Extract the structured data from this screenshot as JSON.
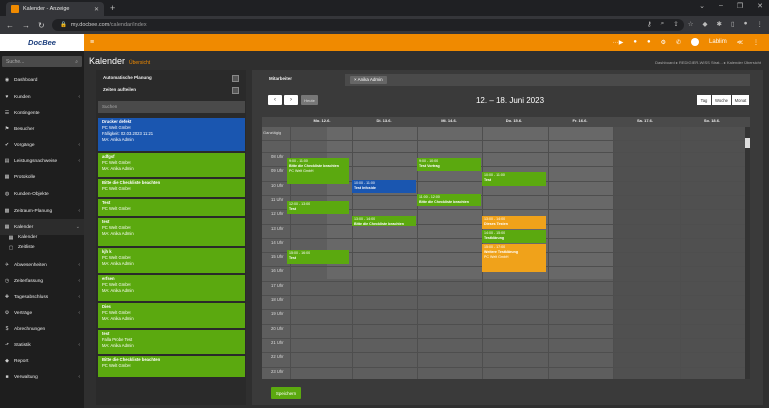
{
  "browser": {
    "tab_title": "Kalender - Anzeige",
    "url_host": "my.docbee.com",
    "url_path": "/calendar/index"
  },
  "app": {
    "logo": "DocBee",
    "page_title": "Kalender",
    "page_subtitle": "Übersicht",
    "breadcrumb": "Dashboard  ▸  REDIGIER-WISS Strat...  ▸  Kalender Übersicht",
    "user": "Lablim"
  },
  "sidebar": {
    "search_placeholder": "Suche...",
    "items": [
      {
        "icon": "◉",
        "label": "Dashboard",
        "chevron": ""
      },
      {
        "icon": "♥",
        "label": "Kunden",
        "chevron": "‹"
      },
      {
        "icon": "☰",
        "label": "Kontingente",
        "chevron": ""
      },
      {
        "icon": "⚑",
        "label": "Besucher",
        "chevron": ""
      },
      {
        "icon": "✔",
        "label": "Vorgänge",
        "chevron": "‹"
      },
      {
        "icon": "▤",
        "label": "Leistungsnachweise",
        "chevron": "‹"
      },
      {
        "icon": "▦",
        "label": "Protokolle",
        "chevron": ""
      },
      {
        "icon": "◍",
        "label": "Kunden-Objekte",
        "chevron": ""
      },
      {
        "icon": "▩",
        "label": "Zeitraum-Planung",
        "chevron": "‹"
      },
      {
        "icon": "▦",
        "label": "Kalender",
        "chevron": "⌄"
      },
      {
        "icon": "▦",
        "label": "Kalender",
        "chevron": ""
      },
      {
        "icon": "▢",
        "label": "Zeitliste",
        "chevron": ""
      },
      {
        "icon": "✈",
        "label": "Abwesenheiten",
        "chevron": "‹"
      },
      {
        "icon": "◷",
        "label": "Zeiterfassung",
        "chevron": "‹"
      },
      {
        "icon": "✚",
        "label": "Tagesabschluss",
        "chevron": "‹"
      },
      {
        "icon": "⚙",
        "label": "Verträge",
        "chevron": "‹"
      },
      {
        "icon": "$",
        "label": "Abrechnungen",
        "chevron": ""
      },
      {
        "icon": "⬏",
        "label": "Statistik",
        "chevron": "‹"
      },
      {
        "icon": "◆",
        "label": "Report",
        "chevron": ""
      },
      {
        "icon": "■",
        "label": "Verwaltung",
        "chevron": "‹"
      }
    ]
  },
  "left_panel": {
    "auto_plan": "Automatische Planung",
    "zeiten": "Zeiten aufteilen",
    "search_placeholder": "Suchen",
    "cards": [
      {
        "title": "Drucker defekt",
        "l1": "PC Welt GmbH",
        "l2": "Fälligkeit: 02.03.2023 11:21",
        "l3": "MA: Anika Admin",
        "color": "blue"
      },
      {
        "title": "adfgsf",
        "l1": "PC Welt GmbH",
        "l2": "MA: Anika Admin",
        "l3": "",
        "color": "green"
      },
      {
        "title": "Bitte die Checkliste beachten",
        "l1": "PC Welt GmbH",
        "l2": "",
        "l3": "",
        "color": "green"
      },
      {
        "title": "Test",
        "l1": "PC Welt GmbH",
        "l2": "",
        "l3": "",
        "color": "green"
      },
      {
        "title": "test",
        "l1": "PC Welt GmbH",
        "l2": "MA: Anika Admin",
        "l3": "",
        "color": "green"
      },
      {
        "title": "kjh k",
        "l1": "PC Welt GmbH",
        "l2": "MA: Anika Admin",
        "l3": "",
        "color": "green"
      },
      {
        "title": "erfsen",
        "l1": "PC Welt GmbH",
        "l2": "MA: Anika Admin",
        "l3": "",
        "color": "green"
      },
      {
        "title": "Dies",
        "l1": "PC Welt GmbH",
        "l2": "MA: Anika Admin",
        "l3": "",
        "color": "green"
      },
      {
        "title": "test",
        "l1": "Falla Probe Test",
        "l2": "MA: Anika Admin",
        "l3": "",
        "color": "green"
      },
      {
        "title": "Bitte die Checkliste beachten",
        "l1": "PC Welt GmbH",
        "l2": "",
        "l3": "",
        "color": "green"
      }
    ]
  },
  "calendar": {
    "mitarbeiter_label": "Mitarbeiter",
    "employee_tag": "× Anika Admin",
    "heute": "Heute",
    "range": "12. – 18. Juni 2023",
    "views": [
      "Tag",
      "Woche",
      "Monat"
    ],
    "ganztaegig": "Ganztägig",
    "days": [
      "Mo. 12.6.",
      "Di. 13.6.",
      "Mi. 14.6.",
      "Do. 15.6.",
      "Fr. 16.6.",
      "Sa. 17.6.",
      "So. 18.6."
    ],
    "hours": [
      "08 Uhr",
      "09 Uhr",
      "10 Uhr",
      "11 Uhr",
      "12 Uhr",
      "13 Uhr",
      "14 Uhr",
      "15 Uhr",
      "16 Uhr",
      "17 Uhr",
      "18 Uhr",
      "19 Uhr",
      "20 Uhr",
      "21 Uhr",
      "22 Uhr",
      "23 Uhr"
    ],
    "events": [
      {
        "time": "9:00 - 11:00",
        "text": "Bitte die Checkliste beachten",
        "sub": "PC Welt GmbH",
        "color": "g"
      },
      {
        "time": "12:00 - 13:00",
        "text": "Test",
        "sub": "",
        "color": "g"
      },
      {
        "time": "10:00 - 11:00",
        "text": "Test Infoside",
        "sub": "",
        "color": "b"
      },
      {
        "time": "13:00 - 14:00",
        "text": "Bitte die Checkliste beachten",
        "sub": "",
        "color": "g"
      },
      {
        "time": "9:00 - 10:00",
        "text": "Test Vortrag",
        "sub": "",
        "color": "g"
      },
      {
        "time": "11:00 - 12:00",
        "text": "Bitte die Checkliste beachten",
        "sub": "",
        "color": "g"
      },
      {
        "time": "10:00 - 11:00",
        "text": "Test",
        "sub": "",
        "color": "g"
      },
      {
        "time": "13:00 - 14:00",
        "text": "Dieses Testen",
        "sub": "",
        "color": "o"
      },
      {
        "time": "14:00 - 15:00",
        "text": "Testklärung",
        "sub": "",
        "color": "g"
      },
      {
        "time": "15:00 - 17:00",
        "text": "Weitere Testklärung",
        "sub": "PC Welt GmbH",
        "color": "o"
      },
      {
        "time": "15:00 - 16:00",
        "text": "Test",
        "sub": "",
        "color": "g"
      }
    ],
    "save": "Speichern"
  },
  "colors": {
    "orange": "#f08a00",
    "green": "#5ba90f",
    "blue": "#1a56b0",
    "event_orange": "#f0a21a"
  }
}
